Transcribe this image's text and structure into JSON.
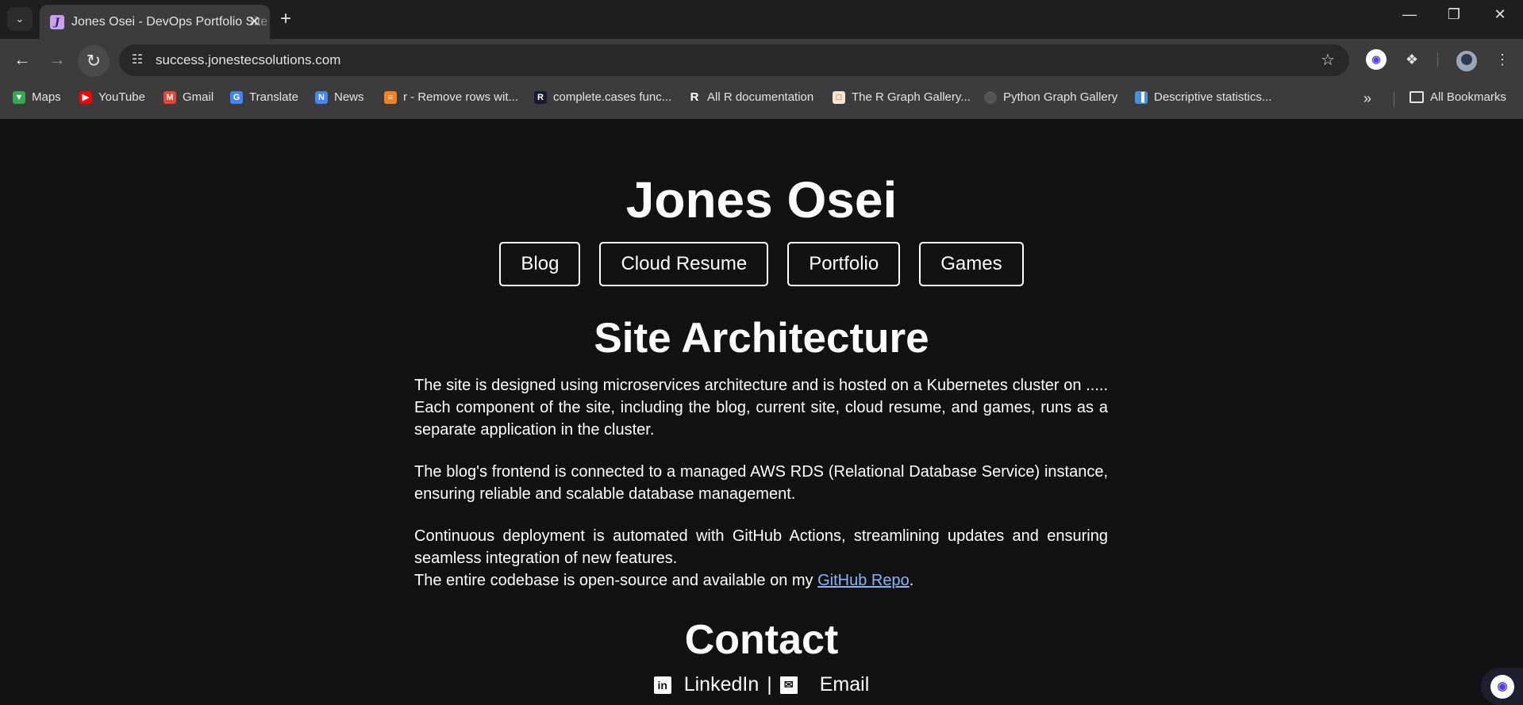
{
  "browser": {
    "tab_title": "Jones Osei - DevOps Portfolio Site",
    "tab_favicon_letter": "J",
    "url": "success.jonestecsolutions.com",
    "bookmarks": [
      {
        "label": "Maps",
        "icon": "maps-icon",
        "color": "#34a853"
      },
      {
        "label": "YouTube",
        "icon": "youtube-icon",
        "color": "#ff0000"
      },
      {
        "label": "Gmail",
        "icon": "gmail-icon",
        "color": "#ea4335"
      },
      {
        "label": "Translate",
        "icon": "translate-icon",
        "color": "#4285f4"
      },
      {
        "label": "News",
        "icon": "news-icon",
        "color": "#4285f4"
      },
      {
        "label": "r - Remove rows wit...",
        "icon": "stackoverflow-icon",
        "color": "#f48024"
      },
      {
        "label": "complete.cases func...",
        "icon": "r-icon",
        "color": "#1a1a2e"
      },
      {
        "label": "All R documentation",
        "icon": "r-icon",
        "color": "#3c3c3c"
      },
      {
        "label": "The R Graph Gallery...",
        "icon": "r-graph-gallery-icon",
        "color": "#f5e6d3"
      },
      {
        "label": "Python Graph Gallery",
        "icon": "python-graph-gallery-icon",
        "color": "#555555"
      },
      {
        "label": "Descriptive statistics...",
        "icon": "stats-icon",
        "color": "#4a90d9"
      }
    ],
    "all_bookmarks_label": "All Bookmarks"
  },
  "page": {
    "name": "Jones Osei",
    "nav": [
      "Blog",
      "Cloud Resume",
      "Portfolio",
      "Games"
    ],
    "architecture": {
      "heading": "Site Architecture",
      "p1": "The site is designed using microservices architecture and is hosted on a Kubernetes cluster on ..... Each component of the site, including the blog, current site, cloud resume, and games, runs as a separate application in the cluster.",
      "p2": "The blog's frontend is connected to a managed AWS RDS (Relational Database Service) instance, ensuring reliable and scalable database management.",
      "p3": "Continuous deployment is automated with GitHub Actions, streamlining updates and ensuring seamless integration of new features.",
      "p4_prefix": "The entire codebase is open-source and available on my ",
      "p4_link": "GitHub Repo",
      "p4_suffix": "."
    },
    "contact": {
      "heading": "Contact",
      "linkedin": "LinkedIn",
      "separator": "|",
      "email": "Email"
    }
  },
  "colors": {
    "page_bg": "#121212",
    "link": "#8ab4f8"
  }
}
